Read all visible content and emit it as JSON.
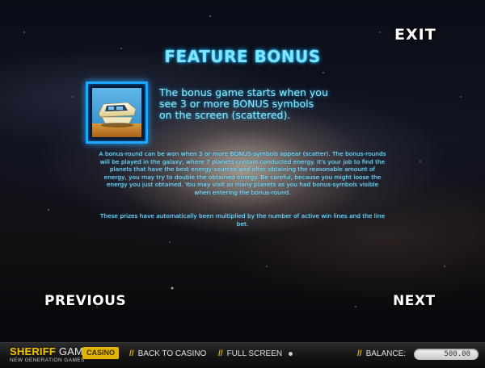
{
  "header": {
    "exit_label": "EXIT",
    "title": "FEATURE BONUS"
  },
  "feature": {
    "symbol_icon": "bonus-spaceship-symbol",
    "intro": "The bonus game starts when you see 3 or more BONUS symbols on the screen (scattered).",
    "description": "A bonus-round can be won when 3 or more BONUS-symbols appear (scatter). The bonus-rounds will be played in the galaxy, where 7 planets contain conducted energy. It's your job to find the planets that have the best energy-sources and after obtaining the reasonable amount of energy, you may try to double the obtained energy. Be careful, because you might loose the energy you just obtained. You may visit as many planets as you had bonus-symbols visible when entering the bonus-round.",
    "prizes_note": "These prizes have automatically been multiplied by the number of active win lines and the line bet."
  },
  "navigation": {
    "previous_label": "PREVIOUS",
    "next_label": "NEXT"
  },
  "footer": {
    "brand_bold": "SHERIFF",
    "brand_light": " GAMING",
    "tagline": "NEW GENERATION GAMES",
    "casino_badge": "CASINO",
    "separator": "//",
    "back_to_casino": "BACK TO CASINO",
    "full_screen": "FULL SCREEN",
    "sound_icon": "sound-toggle-icon",
    "balance_label": "BALANCE:",
    "balance_value": "500.00"
  },
  "colors": {
    "accent": "#1fa7ff",
    "text_cyan": "#8ef0ff",
    "footer_gold": "#e1b400"
  }
}
